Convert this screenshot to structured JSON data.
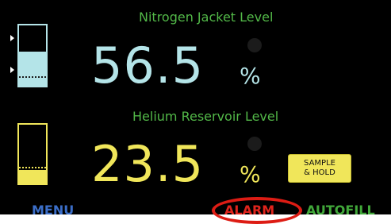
{
  "nitrogen": {
    "title": "Nitrogen Jacket Level",
    "value": "56.5",
    "unit": "%",
    "fill_fraction": 0.56,
    "color": "#b4e4e8"
  },
  "helium": {
    "title": "Helium Reservoir Level",
    "value": "23.5",
    "unit": "%",
    "fill_fraction": 0.235,
    "color": "#f0e65a"
  },
  "title_color": "#52b848",
  "sample_hold": {
    "line1": "SAMPLE",
    "line2": "& HOLD"
  },
  "bottom_bar": {
    "menu": "MENU",
    "alarm": "ALARM",
    "autofill": "AUTOFILL",
    "menu_color": "#3b6ec8",
    "alarm_color": "#e0241c",
    "autofill_color": "#41a83a"
  }
}
